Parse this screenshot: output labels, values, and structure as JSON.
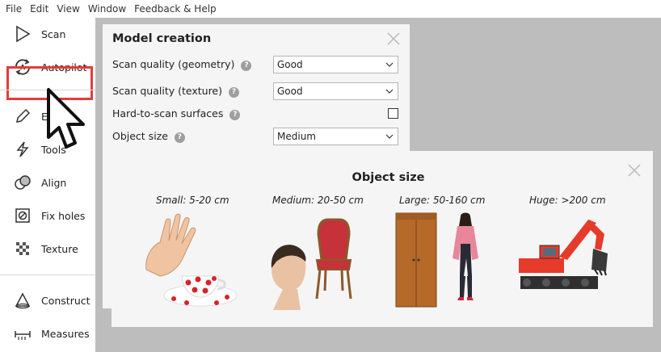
{
  "menu": [
    "File",
    "Edit",
    "View",
    "Window",
    "Feedback & Help"
  ],
  "sidebar": {
    "items": [
      {
        "label": "Scan",
        "icon": "play-triangle-icon"
      },
      {
        "label": "Autopilot",
        "icon": "autopilot-icon"
      },
      {
        "label": "Ed",
        "icon": "pencil-icon"
      },
      {
        "label": "Tools",
        "icon": "lightning-icon"
      },
      {
        "label": "Align",
        "icon": "align-icon"
      },
      {
        "label": "Fix holes",
        "icon": "fix-holes-icon"
      },
      {
        "label": "Texture",
        "icon": "texture-icon"
      },
      {
        "label": "Construct",
        "icon": "construct-icon"
      },
      {
        "label": "Measures",
        "icon": "measures-icon"
      }
    ]
  },
  "panel": {
    "title": "Model creation",
    "rows": [
      {
        "label": "Scan quality (geometry)",
        "value": "Good"
      },
      {
        "label": "Scan quality (texture)",
        "value": "Good"
      },
      {
        "label": "Hard-to-scan surfaces",
        "value": ""
      },
      {
        "label": "Object size",
        "value": "Medium"
      }
    ],
    "hard_to_scan_checked": false
  },
  "popup": {
    "title": "Object size",
    "categories": [
      {
        "label": "Small: 5-20 cm",
        "icon": "hand-and-cup-icon"
      },
      {
        "label": "Medium: 20-50 cm",
        "icon": "head-and-chair-icon"
      },
      {
        "label": "Large: 50-160 cm",
        "icon": "wardrobe-and-person-icon"
      },
      {
        "label": "Huge: >200 cm",
        "icon": "excavator-icon"
      }
    ]
  },
  "colors": {
    "highlight": "#e53c3c",
    "canvas": "#bdbdbd",
    "panel": "#f5f5f5"
  }
}
